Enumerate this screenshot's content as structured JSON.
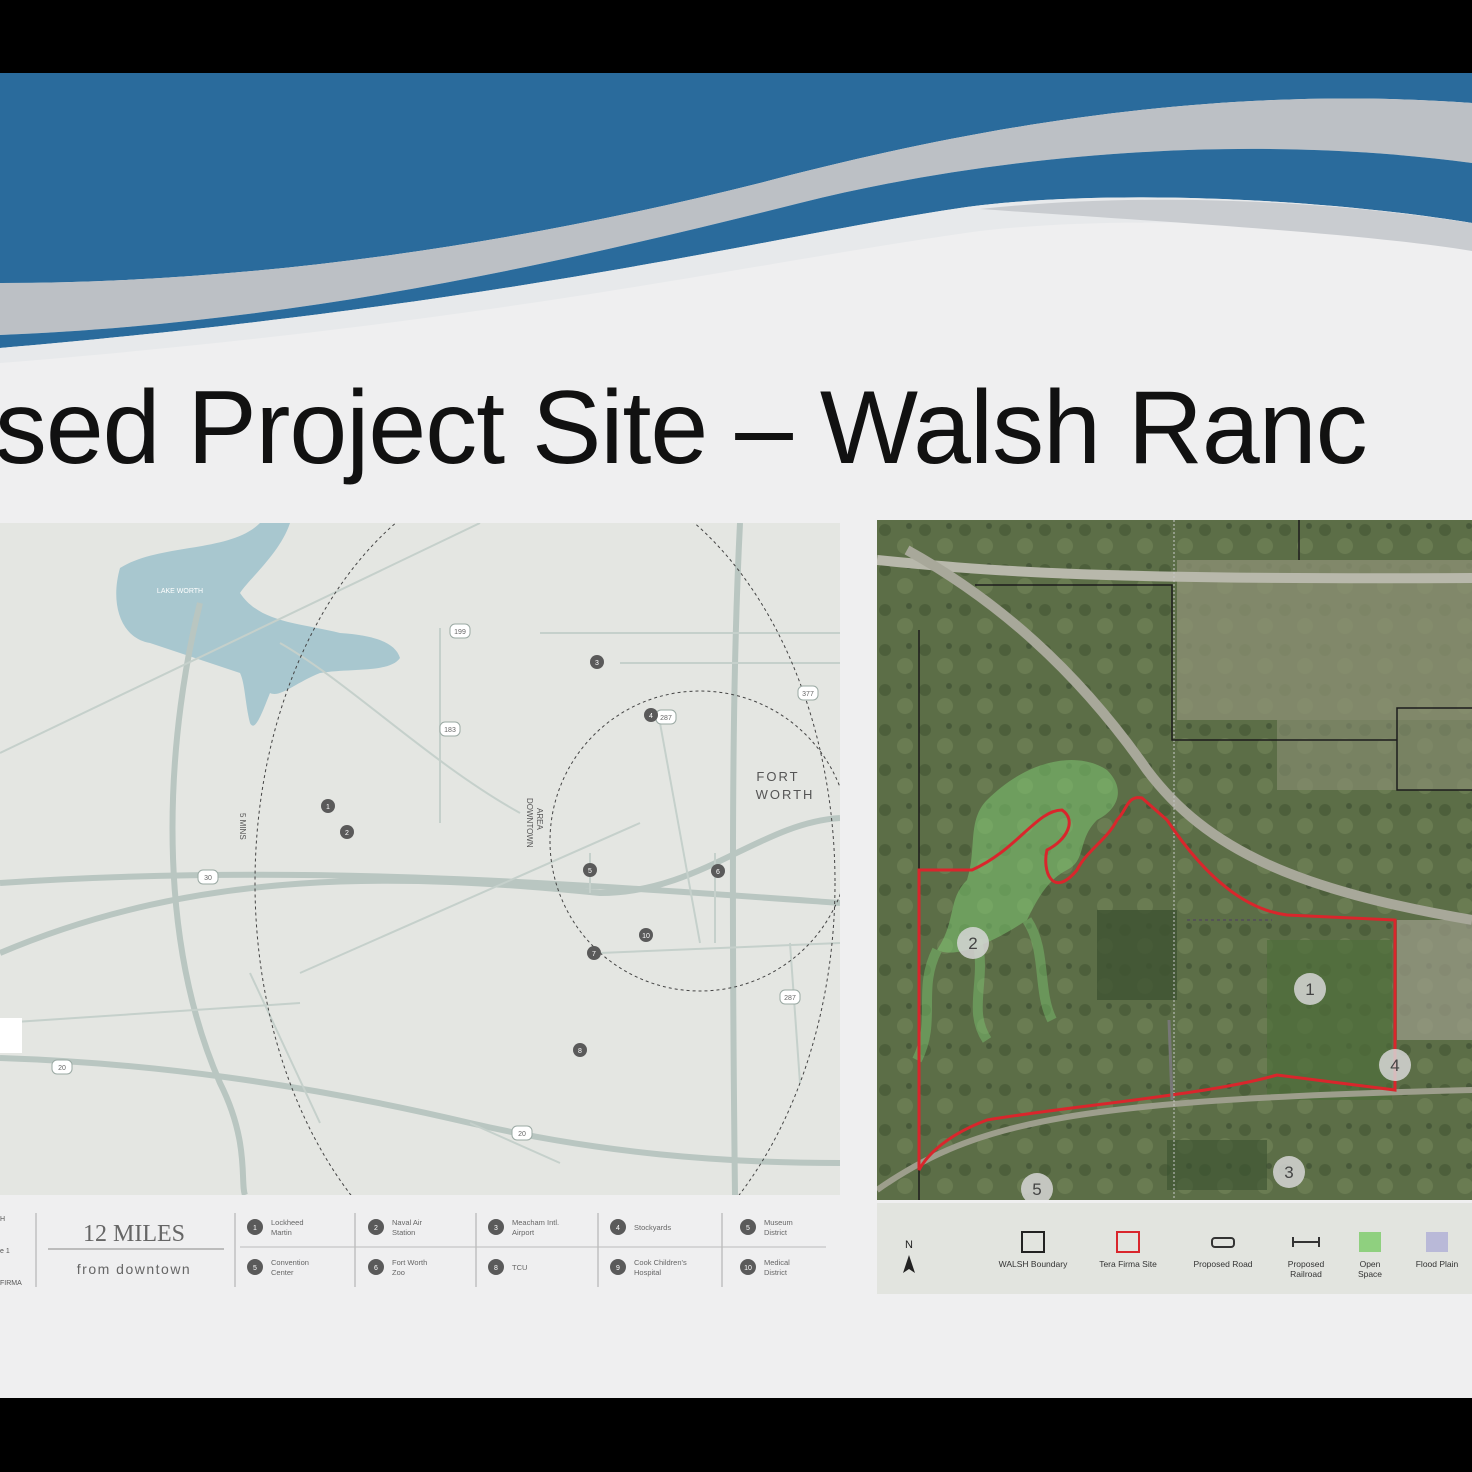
{
  "slide": {
    "title": "osed Project Site – Walsh Ranc",
    "colors": {
      "wave_blue": "#2a6b9c",
      "wave_gray": "#b9bcc1",
      "slide_bg": "#efeff0"
    }
  },
  "left_map": {
    "labels": {
      "lake": "LAKE WORTH",
      "city_line1": "FORT",
      "city_line2": "WORTH",
      "downtown_line1": "DOWNTOWN",
      "downtown_line2": "AREA",
      "ring": "5 MINS"
    },
    "highway_shields": [
      "199",
      "183",
      "287",
      "377",
      "30",
      "20",
      "20",
      "287"
    ],
    "markers": [
      "3",
      "4",
      "1",
      "2",
      "5",
      "6",
      "7",
      "10",
      "8"
    ],
    "legend": {
      "partial_text": [
        "H",
        "e 1",
        "FIRMA"
      ],
      "distance": "12 MILES",
      "distance_sub": "from downtown",
      "items": [
        {
          "num": "1",
          "text": "Lockheed Martin"
        },
        {
          "num": "5",
          "text": "Convention Center"
        },
        {
          "num": "2",
          "text": "Naval Air Station"
        },
        {
          "num": "6",
          "text": "Fort Worth Zoo"
        },
        {
          "num": "3",
          "text": "Meacham Intl. Airport"
        },
        {
          "num": "8",
          "text": "TCU"
        },
        {
          "num": "4",
          "text": "Stockyards"
        },
        {
          "num": "9",
          "text": "Cook Children's Hospital"
        },
        {
          "num": "5",
          "text": "Museum District"
        },
        {
          "num": "10",
          "text": "Medical District"
        }
      ]
    }
  },
  "right_map": {
    "markers": [
      "2",
      "1",
      "4",
      "3",
      "5"
    ],
    "north": "N",
    "legend": [
      {
        "label": "WALSH Boundary",
        "color": "#222222"
      },
      {
        "label": "Tera Firma Site",
        "color": "#d9262c"
      },
      {
        "label": "Proposed Road",
        "color": "#333333"
      },
      {
        "label": "Proposed Railroad",
        "color": "#333333"
      },
      {
        "label": "Open Space",
        "color": "#8fd07f"
      },
      {
        "label": "Flood Plain",
        "color": "#b9b9d8"
      }
    ]
  }
}
